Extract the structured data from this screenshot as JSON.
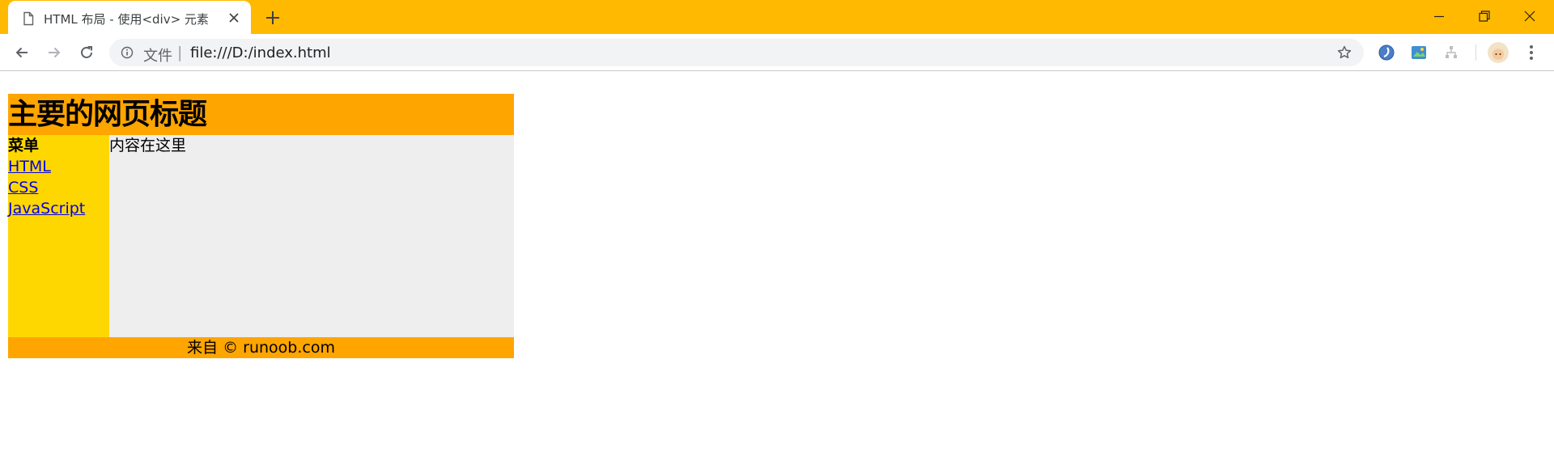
{
  "browser": {
    "tab": {
      "title": "HTML 布局 - 使用<div> 元素"
    },
    "address_bar": {
      "scheme_label": "文件",
      "separator": "|",
      "url": "file:///D:/index.html"
    },
    "colors": {
      "frame": "#FFB900",
      "toolbar": "#FFFFFF",
      "omnibox": "#F1F3F4"
    },
    "icons": {
      "tab_favicon": "document-icon",
      "tab_close": "close-icon",
      "new_tab": "plus-icon",
      "window_minimize": "minimize-icon",
      "window_restore": "restore-icon",
      "window_close": "close-icon",
      "back": "arrow-left-icon",
      "forward": "arrow-right-icon",
      "reload": "reload-icon",
      "site_info": "info-icon",
      "bookmark": "star-icon",
      "extensions": [
        "browser-extension-icon",
        "image-extension-icon",
        "tree-extension-icon"
      ],
      "profile": "avatar-icon",
      "menu": "more-vertical-icon"
    }
  },
  "page": {
    "header": {
      "title": "主要的网页标题"
    },
    "menu": {
      "heading": "菜单",
      "links": [
        "HTML",
        "CSS",
        "JavaScript"
      ]
    },
    "content": {
      "text": "内容在这里"
    },
    "footer": {
      "text": "来自 © runoob.com"
    },
    "colors": {
      "header_bg": "#FFA500",
      "menu_bg": "#FFD700",
      "content_bg": "#EEEEEE",
      "footer_bg": "#FFA500",
      "link": "#0000EE"
    }
  }
}
